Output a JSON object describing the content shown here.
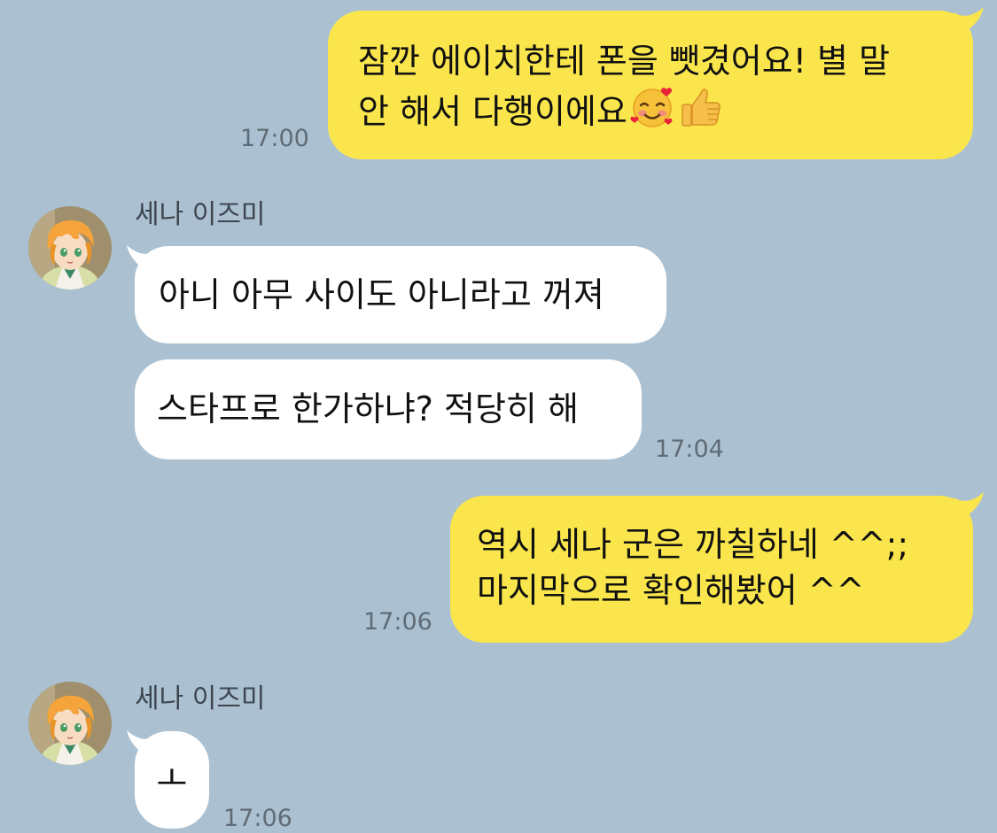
{
  "conversation": {
    "messages": [
      {
        "sender": "me",
        "lines": [
          "잠깐 에이치한테 폰을 뺏겼어요! 별 말",
          "안 해서 다행이에요"
        ],
        "emojis": [
          "smiling-face-with-hearts-emoji",
          "thumbs-up-emoji"
        ],
        "time": "17:00"
      },
      {
        "sender": "세나 이즈미",
        "name": "세나 이즈미",
        "text": "아니 아무 사이도 아니라고 꺼져"
      },
      {
        "sender": "세나 이즈미",
        "text": "스타프로 한가하냐? 적당히 해",
        "time": "17:04"
      },
      {
        "sender": "me",
        "lines": [
          "역시 세나 군은 까칠하네 ^^;;",
          "마지막으로 확인해봤어 ^^"
        ],
        "time": "17:06"
      },
      {
        "sender": "세나 이즈미",
        "name": "세나 이즈미",
        "text": "ㅗ",
        "time": "17:06"
      }
    ]
  },
  "colors": {
    "background": "#abc1d1",
    "my_bubble": "#fae64c",
    "their_bubble": "#ffffff",
    "timestamp": "#5f6c77",
    "sender_name": "#3d4550"
  },
  "icons": [
    "avatar",
    "smiling-face-with-hearts-emoji",
    "thumbs-up-emoji"
  ]
}
